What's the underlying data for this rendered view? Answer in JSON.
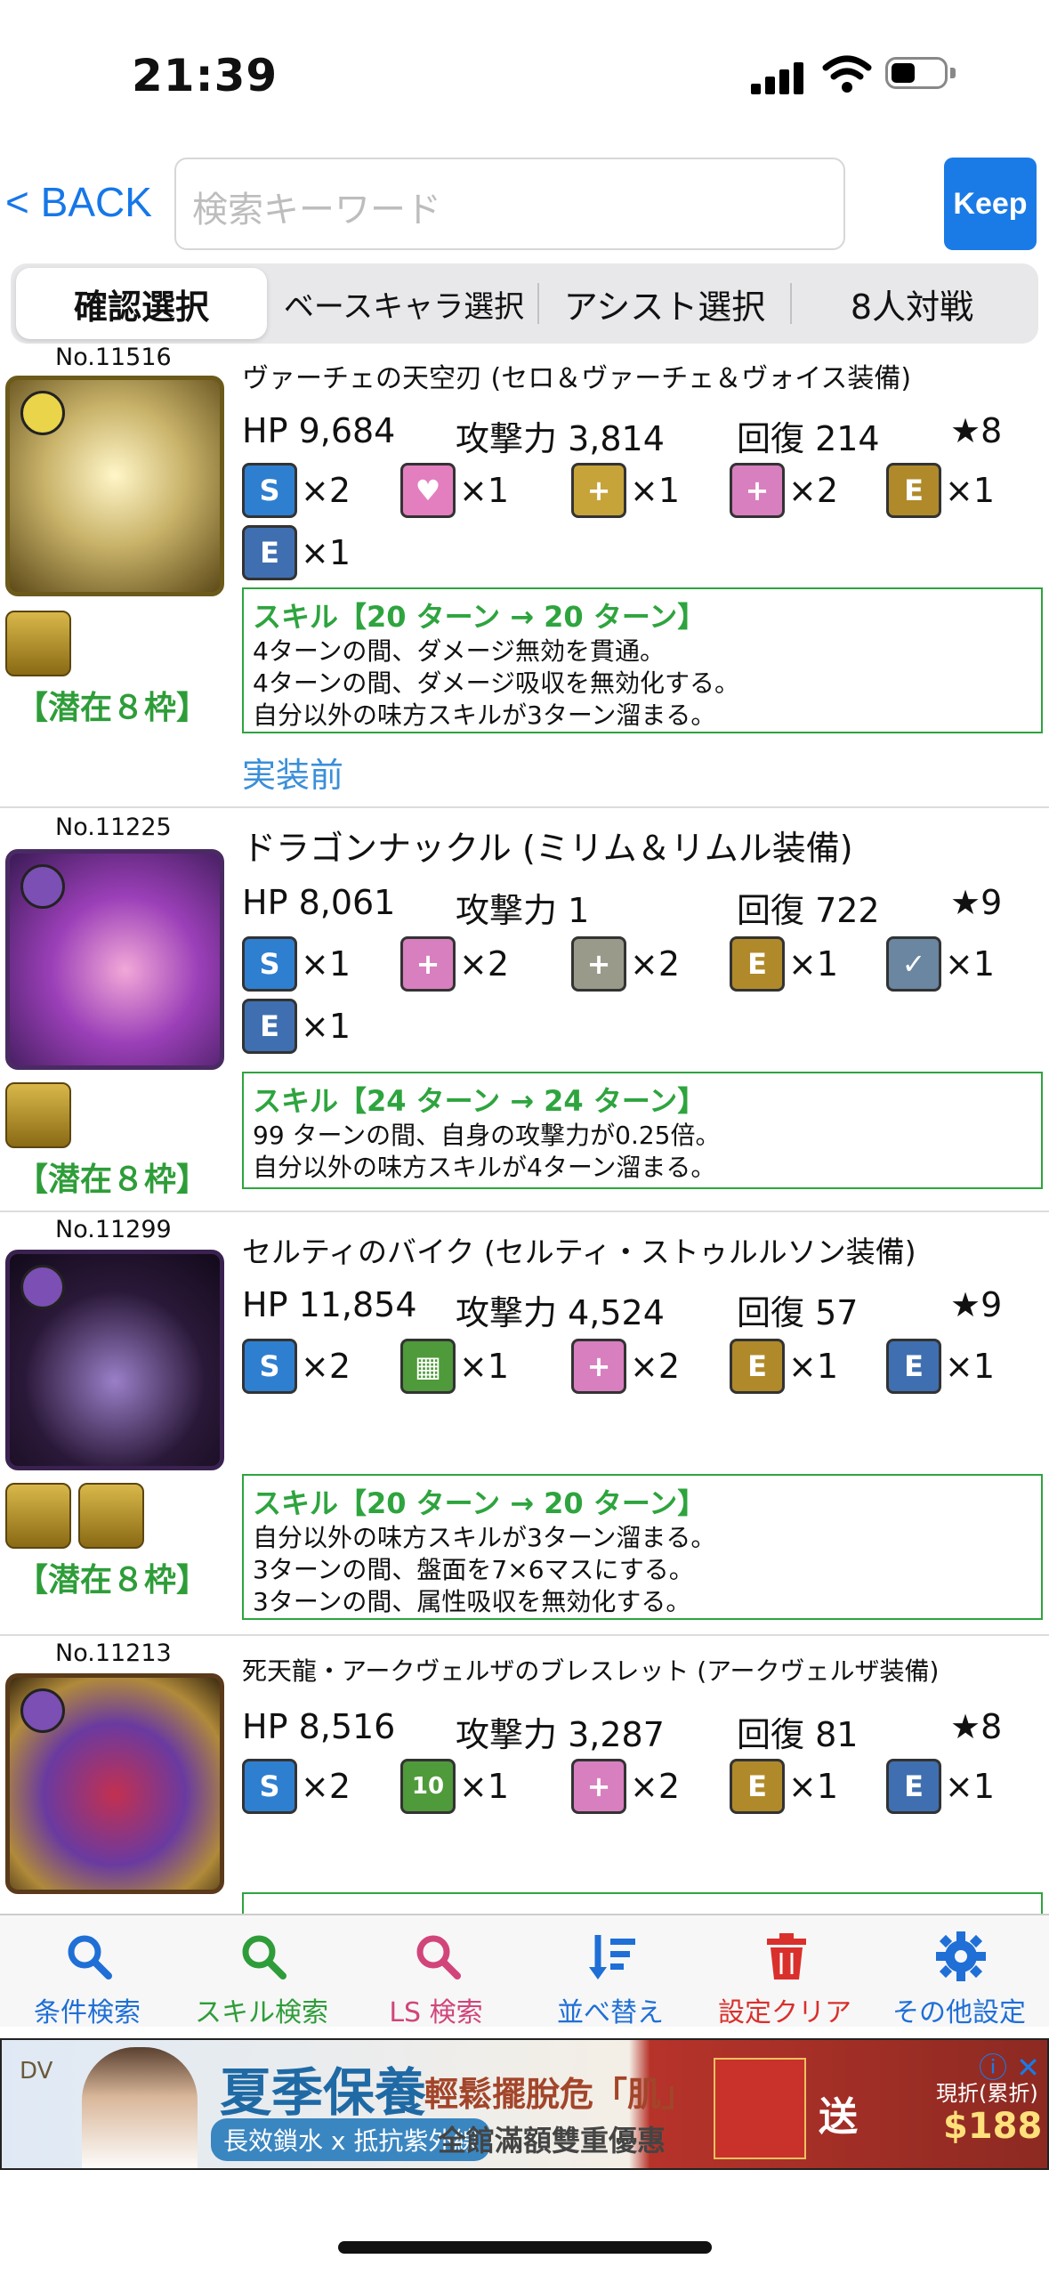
{
  "status": {
    "time": "21:39"
  },
  "header": {
    "back_label": "< BACK",
    "search_placeholder": "検索キーワード",
    "keep_label": "Keep"
  },
  "tabs": [
    {
      "label": "確認選択"
    },
    {
      "label": "ベースキャラ選択"
    },
    {
      "label": "アシスト選択"
    },
    {
      "label": "8人対戦"
    }
  ],
  "cards": [
    {
      "number": "No.11516",
      "name": "ヴァーチェの天空刃 (セロ＆ヴァーチェ＆ヴォイス装備)",
      "hp": "HP 9,684",
      "atk": "攻撃力 3,814",
      "rcv": "回復 214",
      "rarity": "★8",
      "awakenings": [
        {
          "icon": "skill-boost-plus-icon",
          "count": "×2"
        },
        {
          "icon": "heart-plus-icon",
          "count": "×1"
        },
        {
          "icon": "recovery-plus-icon",
          "count": "×1"
        },
        {
          "icon": "team-heal-plus-icon",
          "count": "×2"
        },
        {
          "icon": "equip-guard-icon",
          "count": "×1"
        },
        {
          "icon": "equip-sword-icon",
          "count": "×1"
        }
      ],
      "skill_title": "スキル【20 ターン → 20 ターン】",
      "skill_lines": [
        "4ターンの間、ダメージ無効を貫通。",
        "4ターンの間、ダメージ吸収を無効化する。",
        "自分以外の味方スキルが3ターン溜まる。"
      ],
      "latent_label": "【潜在８枠】",
      "status_note": "実装前"
    },
    {
      "number": "No.11225",
      "name": "ドラゴンナックル (ミリム＆リムル装備)",
      "hp": "HP 8,061",
      "atk": "攻撃力 1",
      "rcv": "回復 722",
      "rarity": "★9",
      "awakenings": [
        {
          "icon": "skill-boost-plus-icon",
          "count": "×1"
        },
        {
          "icon": "team-heal-plus-icon",
          "count": "×2"
        },
        {
          "icon": "team-attack-plus-icon",
          "count": "×2"
        },
        {
          "icon": "equip-dragon-icon",
          "count": "×1"
        },
        {
          "icon": "unbind-icon",
          "count": "×1"
        },
        {
          "icon": "equip-sword-icon",
          "count": "×1"
        }
      ],
      "skill_title": "スキル【24 ターン → 24 ターン】",
      "skill_lines": [
        "99 ターンの間、自身の攻撃力が0.25倍。",
        "自分以外の味方スキルが4ターン溜まる。"
      ],
      "latent_label": "【潜在８枠】"
    },
    {
      "number": "No.11299",
      "name": "セルティのバイク (セルティ・ストゥルルソン装備)",
      "hp": "HP 11,854",
      "atk": "攻撃力 4,524",
      "rcv": "回復 57",
      "rarity": "★9",
      "awakenings": [
        {
          "icon": "skill-boost-plus-icon",
          "count": "×2"
        },
        {
          "icon": "board-7x6-icon",
          "count": "×1"
        },
        {
          "icon": "team-heal-plus-icon",
          "count": "×2"
        },
        {
          "icon": "equip-gear-icon",
          "count": "×1"
        },
        {
          "icon": "equip-sword-icon",
          "count": "×1"
        }
      ],
      "skill_title": "スキル【20 ターン → 20 ターン】",
      "skill_lines": [
        "自分以外の味方スキルが3ターン溜まる。",
        "3ターンの間、盤面を7×6マスにする。",
        "3ターンの間、属性吸収を無効化する。"
      ],
      "latent_label": "【潜在８枠】"
    },
    {
      "number": "No.11213",
      "name": "死天龍・アークヴェルザのブレスレット (アークヴェルザ装備)",
      "hp": "HP 8,516",
      "atk": "攻撃力 3,287",
      "rcv": "回復 81",
      "rarity": "★8",
      "awakenings": [
        {
          "icon": "skill-boost-plus-icon",
          "count": "×2"
        },
        {
          "icon": "ten-combo-icon",
          "count": "×1"
        },
        {
          "icon": "team-heal-plus-icon",
          "count": "×2"
        },
        {
          "icon": "equip-devil-icon",
          "count": "×1"
        },
        {
          "icon": "equip-sword-icon",
          "count": "×1"
        }
      ]
    }
  ],
  "bottom_nav": [
    {
      "label": "条件検索",
      "icon": "search-icon",
      "color": "#1f6fd6"
    },
    {
      "label": "スキル検索",
      "icon": "search-icon",
      "color": "#2f9c3a"
    },
    {
      "label": "LS 検索",
      "icon": "search-icon",
      "color": "#d1457a"
    },
    {
      "label": "並べ替え",
      "icon": "sort-icon",
      "color": "#1f6fd6"
    },
    {
      "label": "設定クリア",
      "icon": "trash-icon",
      "color": "#d9302c"
    },
    {
      "label": "その他設定",
      "icon": "gear-icon",
      "color": "#1f6fd6"
    }
  ],
  "ad": {
    "title": "夏季保養",
    "tagline": "輕鬆擺脫危「肌」",
    "pill": "長效鎖水 x 抵抗紫外線",
    "offer": "全館滿額雙重優惠",
    "send": "送",
    "price_label": "現折(累折)",
    "price": "$188"
  }
}
